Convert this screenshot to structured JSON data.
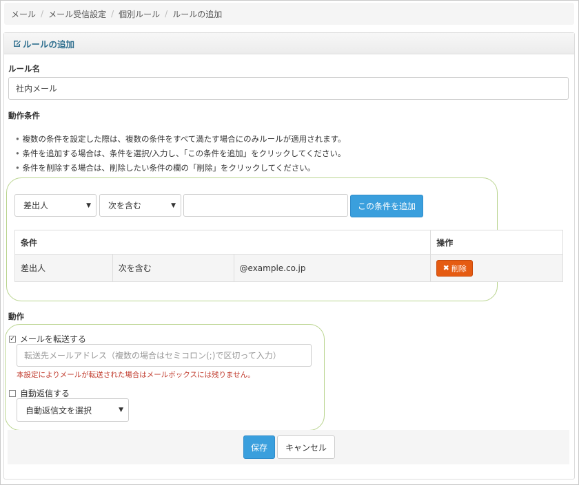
{
  "breadcrumb": [
    "メール",
    "メール受信設定",
    "個別ルール",
    "ルールの追加"
  ],
  "panel": {
    "title": "ルールの追加",
    "icon": "edit-icon"
  },
  "rule_name": {
    "label": "ルール名",
    "value": "社内メール"
  },
  "conditions": {
    "label": "動作条件",
    "notes": [
      "複数の条件を設定した際は、複数の条件をすべて満たす場合にのみルールが適用されます。",
      "条件を追加する場合は、条件を選択/入力し、「この条件を追加」をクリックしてください。",
      "条件を削除する場合は、削除したい条件の欄の「削除」をクリックしてください。"
    ],
    "field_select": "差出人",
    "operator_select": "次を含む",
    "value_input": "",
    "add_button": "この条件を追加",
    "table": {
      "headers": [
        "条件",
        "操作"
      ],
      "rows": [
        {
          "field": "差出人",
          "operator": "次を含む",
          "value": "@example.co.jp",
          "action": "削除"
        }
      ]
    }
  },
  "actions": {
    "label": "動作",
    "forward": {
      "label": "メールを転送する",
      "checked": true,
      "placeholder": "転送先メールアドレス（複数の場合はセミコロン(;)で区切って入力）",
      "warning": "本設定によりメールが転送された場合はメールボックスには残りません。"
    },
    "auto_reply": {
      "label": "自動返信する",
      "checked": false,
      "select": "自動返信文を選択"
    }
  },
  "footer": {
    "save": "保存",
    "cancel": "キャンセル"
  },
  "colors": {
    "accent": "#3a9fdd",
    "danger": "#e55b12",
    "highlight": "#b9d48e",
    "warning_text": "#c0392b"
  }
}
